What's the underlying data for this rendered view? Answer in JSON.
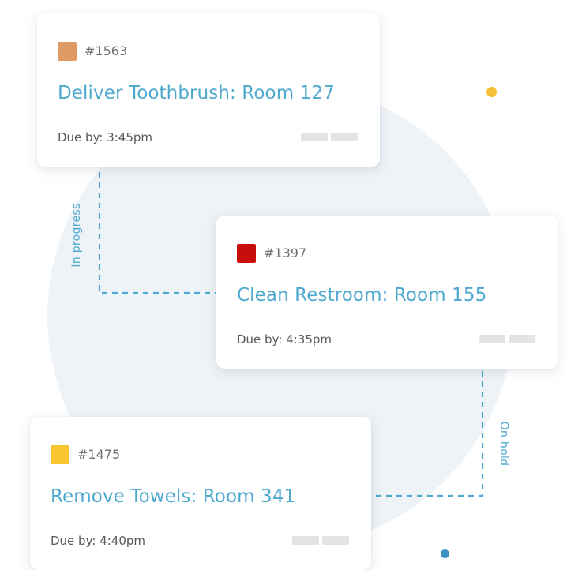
{
  "colors": {
    "accent": "#4fa9cf",
    "dot_yellow": "#f5c13a",
    "dot_blue": "#3a93c2"
  },
  "statuses": {
    "in_progress": "In progress",
    "on_hold": "On hold"
  },
  "tickets": [
    {
      "id": "#1563",
      "color": "#e09a64",
      "title": "Deliver Toothbrush: Room 127",
      "due": "Due by: 3:45pm"
    },
    {
      "id": "#1397",
      "color": "#c80d0d",
      "title": "Clean Restroom: Room 155",
      "due": "Due by: 4:35pm"
    },
    {
      "id": "#1475",
      "color": "#f8c430",
      "title": "Remove Towels: Room 341",
      "due": "Due by: 4:40pm"
    }
  ]
}
